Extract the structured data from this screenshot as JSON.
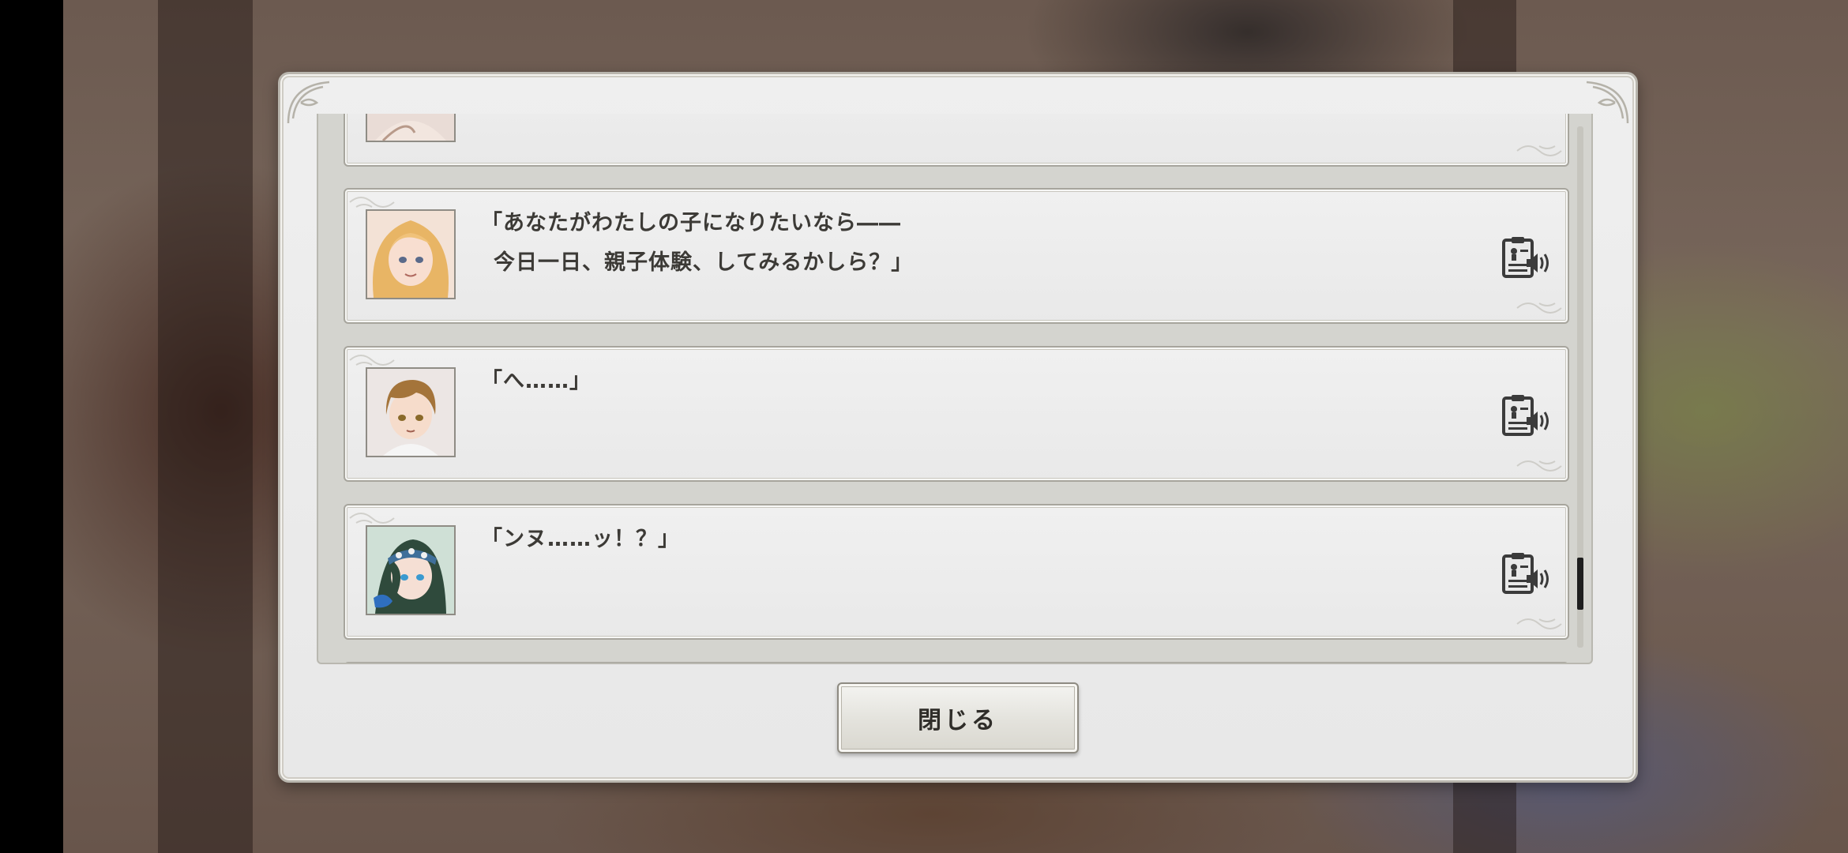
{
  "log": {
    "entries": [
      {
        "speaker_icon": "portrait-blonde-woman",
        "lines": []
      },
      {
        "speaker_icon": "portrait-blonde-woman",
        "lines": [
          "「あなたがわたしの子になりたいなら――",
          "今日一日、親子体験、してみるかしら？」"
        ]
      },
      {
        "speaker_icon": "portrait-brown-haired-boy",
        "lines": [
          "「へ……」"
        ]
      },
      {
        "speaker_icon": "portrait-dark-haired-elf-girl",
        "lines": [
          "「ンヌ……ッ！？」"
        ]
      },
      {
        "speaker_icon": "",
        "lines": []
      }
    ],
    "voice_icon": "voice-replay-icon",
    "scroll_position": 0.92
  },
  "close_button": {
    "label": "閉じる"
  },
  "colors": {
    "panel": "#ebebeb",
    "border": "#a7a59d",
    "text": "#3c3a36"
  }
}
